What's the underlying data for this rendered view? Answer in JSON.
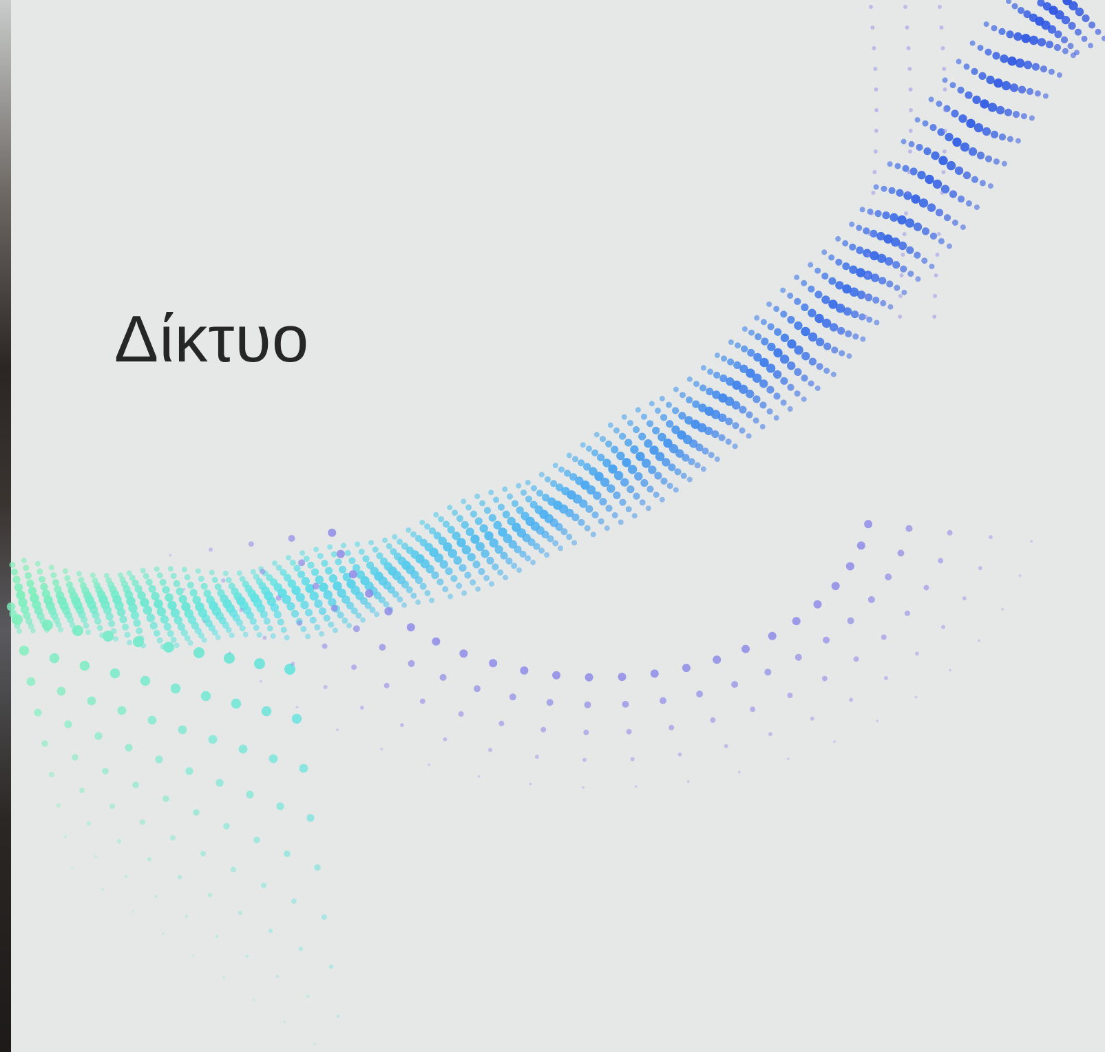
{
  "slide": {
    "title": "Δίκτυο"
  },
  "theme": {
    "background": "#e5e8e7",
    "title_color": "#262626",
    "wave_colors": [
      "#7ef0b8",
      "#5fe0e6",
      "#4fb0f0",
      "#3a6ee8",
      "#2b4fe0",
      "#8a84e8"
    ]
  },
  "decoration": {
    "graphic": "dotted-particle-wave"
  }
}
